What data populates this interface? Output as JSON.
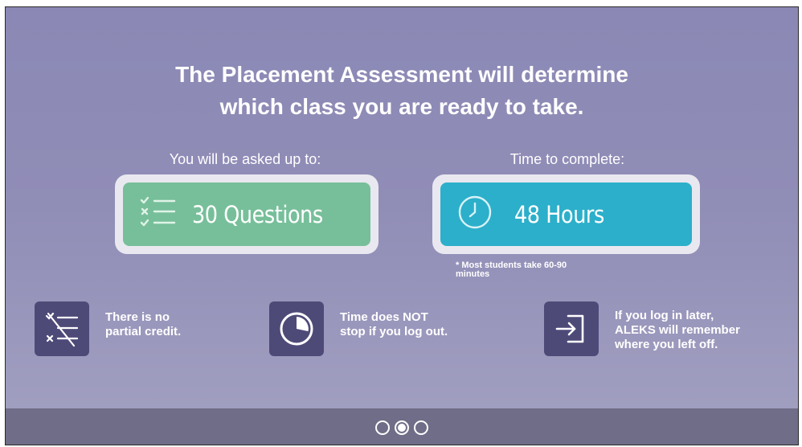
{
  "headline": {
    "line1": "The Placement Assessment will determine",
    "line2": "which class you are ready to take."
  },
  "questions_card": {
    "label": "You will be asked up to:",
    "value": "30 Questions",
    "icon": "checklist-icon",
    "color": "#77bf9a"
  },
  "time_card": {
    "label": "Time to complete:",
    "value": "48 Hours",
    "icon": "clock-icon",
    "color": "#2cafca",
    "footnote_line1": "* Most students take 60-90",
    "footnote_line2": "minutes"
  },
  "info_items": [
    {
      "icon": "no-partial-credit-icon",
      "line1": "There is no",
      "line2": "partial credit."
    },
    {
      "icon": "timer-icon",
      "line1": "Time does NOT",
      "line2": "stop if you log out."
    },
    {
      "icon": "login-icon",
      "line1": "If you log in later,",
      "line2": "ALEKS will remember",
      "line3": "where you left off."
    }
  ],
  "pagination": {
    "total_pages": 3,
    "current_page": 2
  }
}
